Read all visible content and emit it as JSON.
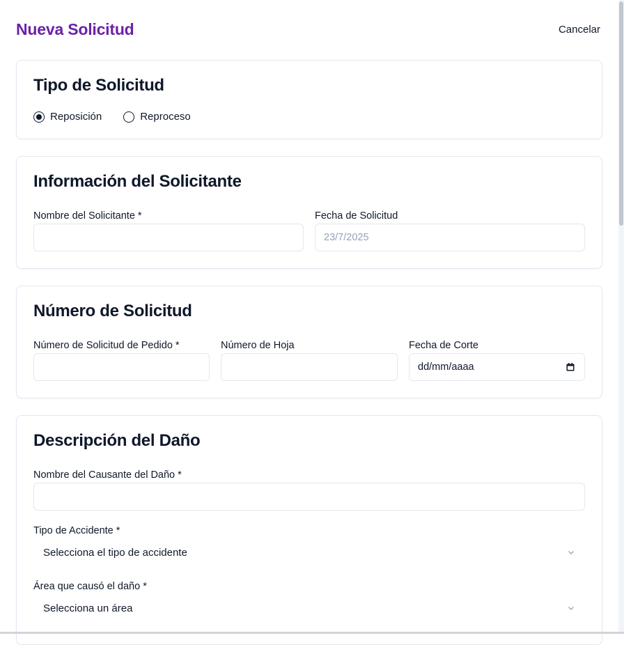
{
  "header": {
    "title": "Nueva Solicitud",
    "cancel_label": "Cancelar"
  },
  "tipo": {
    "title": "Tipo de Solicitud",
    "options": [
      {
        "label": "Reposición",
        "selected": true
      },
      {
        "label": "Reproceso",
        "selected": false
      }
    ]
  },
  "solicitante": {
    "title": "Información del Solicitante",
    "nombre_label": "Nombre del Solicitante *",
    "nombre_value": "",
    "fecha_label": "Fecha de Solicitud",
    "fecha_value": "23/7/2025"
  },
  "numero": {
    "title": "Número de Solicitud",
    "pedido_label": "Número de Solicitud de Pedido *",
    "pedido_value": "",
    "hoja_label": "Número de Hoja",
    "hoja_value": "",
    "corte_label": "Fecha de Corte",
    "corte_placeholder": "dd/mm/aaaa"
  },
  "dano": {
    "title": "Descripción del Daño",
    "causante_label": "Nombre del Causante del Daño *",
    "causante_value": "",
    "accidente_label": "Tipo de Accidente *",
    "accidente_placeholder": "Selecciona el tipo de accidente",
    "area_label": "Área que causó el daño *",
    "area_placeholder": "Selecciona un área"
  },
  "colors": {
    "title_purple": "#6b21a8",
    "text": "#0f172a",
    "border": "#e2e8f0",
    "muted": "#94a3b8"
  }
}
